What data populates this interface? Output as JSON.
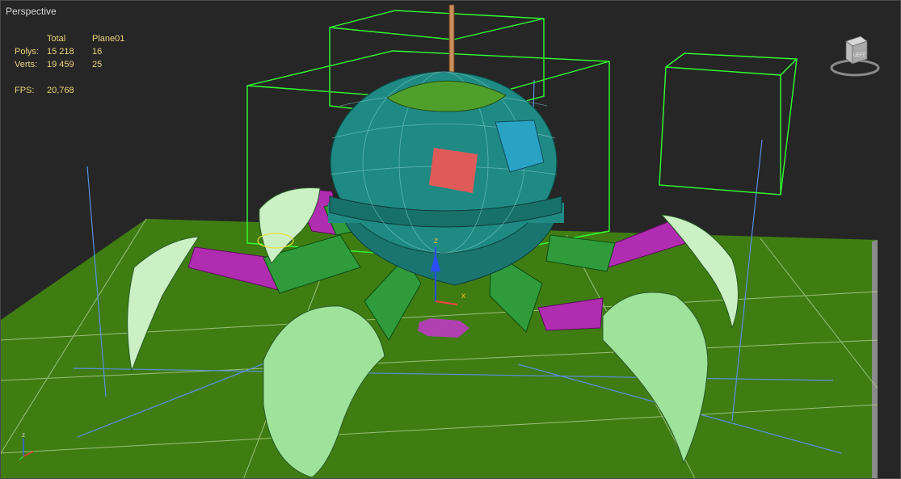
{
  "viewport": {
    "label": "Perspective"
  },
  "stats": {
    "headers": [
      "",
      "Total",
      "Plane01"
    ],
    "rows": [
      {
        "label": "Polys:",
        "total": "15 218",
        "selected": "16"
      },
      {
        "label": "Verts:",
        "total": "19 459",
        "selected": "25"
      }
    ],
    "fps_label": "FPS:",
    "fps_value": "20,768"
  },
  "viewcube": {
    "face_label": "LEFT"
  },
  "gizmo": {
    "x_label": "x",
    "z_label": "z"
  },
  "tripod": {
    "z_label": "z"
  },
  "colors": {
    "background": "#262626",
    "ground": "#3f7d12",
    "body": "#1f8a84",
    "selection_box": "#33ff33",
    "joint": "#b02cb0",
    "claw": "#9fe39a",
    "stats_text": "#e8d27a"
  }
}
